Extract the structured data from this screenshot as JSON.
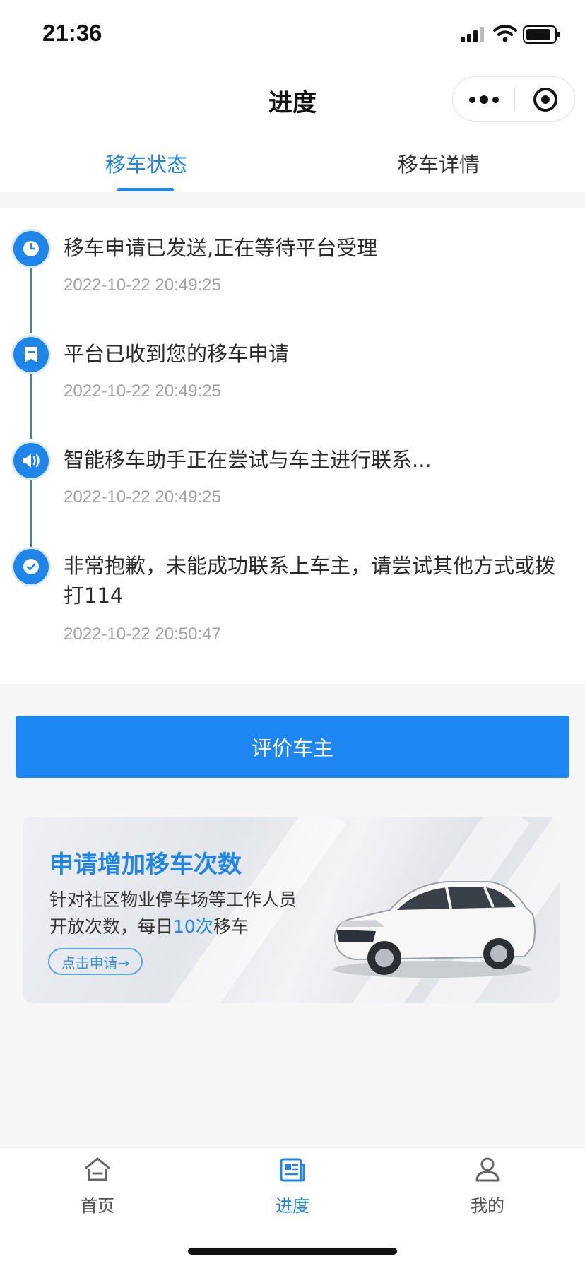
{
  "status_bar": {
    "time": "21:36"
  },
  "nav": {
    "title": "进度"
  },
  "tabs": [
    {
      "label": "移车状态",
      "active": true
    },
    {
      "label": "移车详情",
      "active": false
    }
  ],
  "timeline": [
    {
      "icon": "clock-icon",
      "text": "移车申请已发送,正在等待平台受理",
      "time": "2022-10-22 20:49:25"
    },
    {
      "icon": "bookmark-icon",
      "text": "平台已收到您的移车申请",
      "time": "2022-10-22 20:49:25"
    },
    {
      "icon": "speaker-icon",
      "text": "智能移车助手正在尝试与车主进行联系...",
      "time": "2022-10-22 20:49:25"
    },
    {
      "icon": "check-icon",
      "text": "非常抱歉，未能成功联系上车主，请尝试其他方式或拨打114",
      "time": "2022-10-22 20:50:47"
    }
  ],
  "rate_button": "评价车主",
  "banner": {
    "title": "申请增加移车次数",
    "line1": "针对社区物业停车场等工作人员",
    "line2_prefix": "开放次数，每日",
    "line2_highlight": "10次",
    "line2_suffix": "移车",
    "cta": "点击申请→"
  },
  "tabbar": [
    {
      "label": "首页",
      "icon": "home-icon",
      "active": false
    },
    {
      "label": "进度",
      "icon": "progress-icon",
      "active": true
    },
    {
      "label": "我的",
      "icon": "user-icon",
      "active": false
    }
  ],
  "colors": {
    "accent": "#1f85e8",
    "button": "#1f87f3",
    "muted": "#a2a2a2"
  }
}
